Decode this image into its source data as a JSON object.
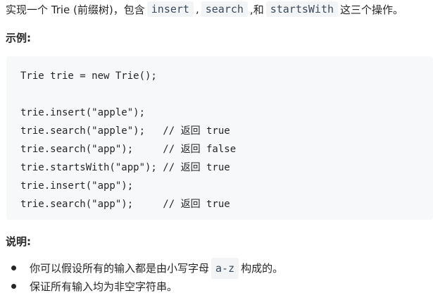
{
  "intro": {
    "prefix": "实现一个 Trie (前缀树)，包含",
    "code1": "insert",
    "sep1": ",",
    "code2": "search",
    "sep2": ",和",
    "code3": "startsWith",
    "suffix": "这三个操作。"
  },
  "example_heading": "示例:",
  "code_lines": [
    "Trie trie = new Trie();",
    "",
    "trie.insert(\"apple\");",
    "trie.search(\"apple\");   // 返回 true",
    "trie.search(\"app\");     // 返回 false",
    "trie.startsWith(\"app\"); // 返回 true",
    "trie.insert(\"app\");",
    "trie.search(\"app\");     // 返回 true"
  ],
  "note_heading": "说明:",
  "notes": [
    {
      "prefix": "你可以假设所有的输入都是由小写字母",
      "code": "a-z",
      "suffix": "构成的。"
    },
    {
      "prefix": "保证所有输入均为非空字符串。"
    }
  ]
}
